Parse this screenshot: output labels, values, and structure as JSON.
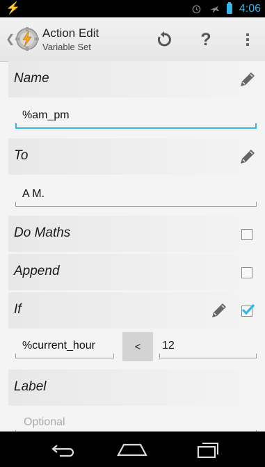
{
  "status_bar": {
    "time": "4:06",
    "left_icon": "flash-icon",
    "icons": [
      "alarm-icon",
      "airplane-mode-icon",
      "battery-icon"
    ]
  },
  "action_bar": {
    "title": "Action Edit",
    "subtitle": "Variable Set",
    "icons": [
      "app-icon",
      "undo-icon",
      "help-icon",
      "overflow-menu-icon"
    ],
    "help_label": "?"
  },
  "sections": {
    "name": {
      "label": "Name",
      "value": "%am_pm"
    },
    "to": {
      "label": "To",
      "value": "A M."
    },
    "do_maths": {
      "label": "Do Maths",
      "checked": false
    },
    "append": {
      "label": "Append",
      "checked": false
    },
    "if": {
      "label": "If",
      "checked": true,
      "left_value": "%current_hour",
      "operator": "<",
      "right_value": "12"
    },
    "label": {
      "label": "Label",
      "placeholder": "Optional"
    }
  },
  "colors": {
    "accent": "#33b5e5",
    "status_bar_bg": "#000000",
    "background": "#f4f4f4"
  },
  "nav_bar": {
    "icons": [
      "back-icon",
      "home-icon",
      "recents-icon"
    ]
  }
}
